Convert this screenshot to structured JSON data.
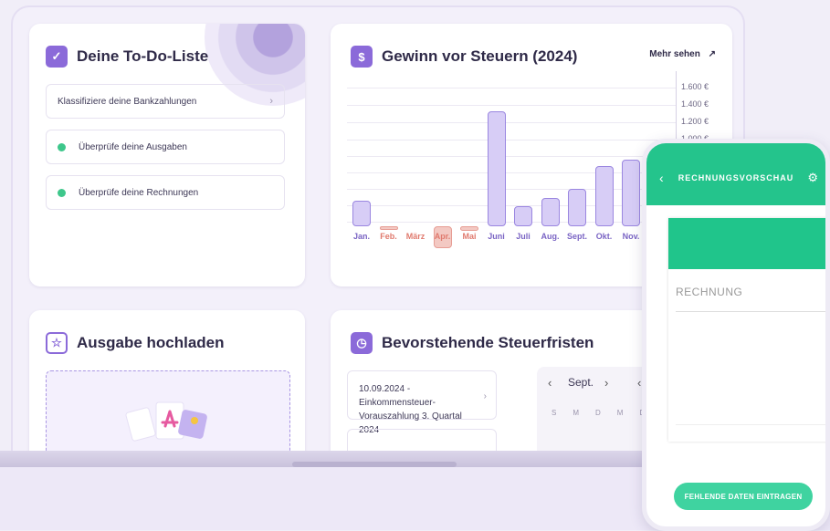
{
  "todo": {
    "title": "Deine To-Do-Liste",
    "items": [
      {
        "label": "Klassifiziere deine Bankzahlungen",
        "done": false
      },
      {
        "label": "Überprüfe deine Ausgaben",
        "done": true
      },
      {
        "label": "Überprüfe deine Rechnungen",
        "done": true
      }
    ]
  },
  "profit": {
    "title": "Gewinn vor Steuern (2024)",
    "more_label": "Mehr sehen",
    "y_ticks": [
      "1.600 €",
      "1.400 €",
      "1.200 €",
      "1.000 €"
    ]
  },
  "chart_data": {
    "type": "bar",
    "title": "Gewinn vor Steuern (2024)",
    "categories": [
      "Jan.",
      "Feb.",
      "März",
      "Apr.",
      "Mai",
      "Juni",
      "Juli",
      "Aug.",
      "Sept.",
      "Okt.",
      "Nov."
    ],
    "values": [
      300,
      -20,
      0,
      -250,
      -50,
      1330,
      230,
      330,
      430,
      700,
      770
    ],
    "highlight": "Apr.",
    "ylim": [
      -300,
      1600
    ],
    "colors": {
      "positive": "#d7cdf6",
      "negative": "#f3c9c3",
      "positive_stroke": "#9a86e0",
      "negative_stroke": "#e79d94",
      "positive_label": "#7a64c4",
      "negative_label": "#e07a6e"
    }
  },
  "upload": {
    "title": "Ausgabe hochladen"
  },
  "deadlines": {
    "title": "Bevorstehende Steuerfristen",
    "items": [
      {
        "label": "10.09.2024 - Einkommensteuer-Vorauszahlung 3. Quartal 2024"
      }
    ],
    "calendar": {
      "month": "Sept.",
      "days": [
        "S",
        "M",
        "D",
        "M",
        "D"
      ]
    }
  },
  "phone": {
    "header_title": "RECHNUNGSVORSCHAU",
    "invoice_title": "RECHNUNG",
    "button_label": "FEHLENDE DATEN EINTRAGEN"
  },
  "colors": {
    "accent": "#8b6ad9",
    "green": "#24c48c",
    "background": "#f1eef8"
  }
}
